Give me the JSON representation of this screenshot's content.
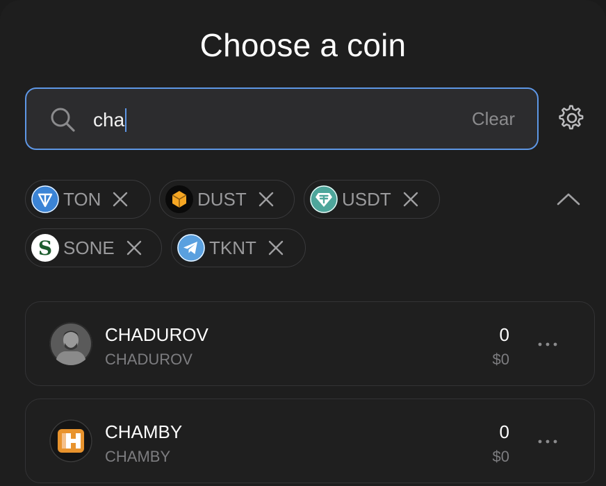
{
  "header": {
    "title": "Choose a coin"
  },
  "search": {
    "value": "cha",
    "clear_label": "Clear"
  },
  "selected_tokens": [
    {
      "symbol": "TON",
      "icon": "ton-logo-icon"
    },
    {
      "symbol": "DUST",
      "icon": "dust-logo-icon"
    },
    {
      "symbol": "USDT",
      "icon": "usdt-logo-icon"
    },
    {
      "symbol": "SONE",
      "icon": "sone-logo-icon"
    },
    {
      "symbol": "TKNT",
      "icon": "telegram-logo-icon"
    }
  ],
  "results": [
    {
      "name": "CHADUROV",
      "subtitle": "CHADUROV",
      "amount": "0",
      "fiat": "$0",
      "icon": "chadurov-avatar"
    },
    {
      "name": "CHAMBY",
      "subtitle": "CHAMBY",
      "amount": "0",
      "fiat": "$0",
      "icon": "chamby-logo"
    }
  ],
  "colors": {
    "background": "#1e1e1e",
    "accent": "#5e97e6",
    "muted_text": "#7d7d80",
    "ton": "#3b84d6",
    "dust": "#f5a623",
    "usdt": "#4ea69b",
    "sone": "#1d5c2e",
    "telegram": "#5aa0df",
    "chamby": "#e8932d"
  }
}
